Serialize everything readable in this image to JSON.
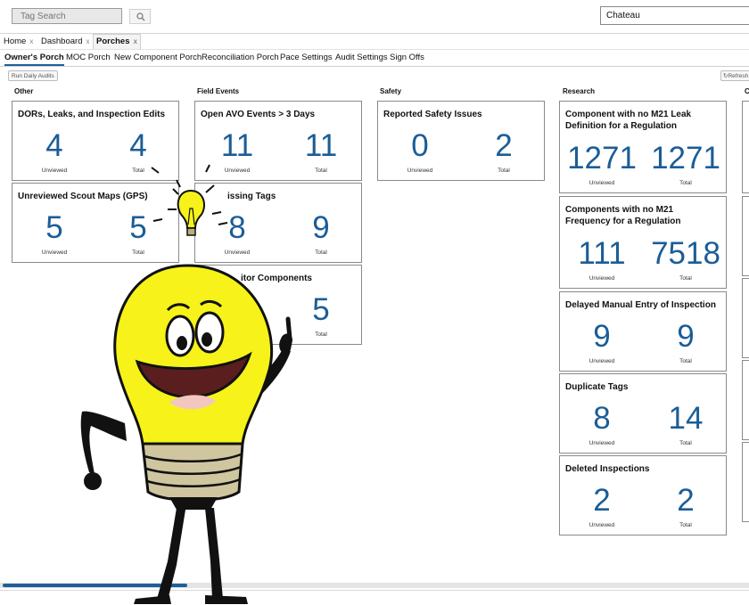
{
  "header": {
    "search_placeholder": "Tag Search",
    "site_value": "Chateau"
  },
  "nav_tabs": [
    {
      "label": "Home",
      "closable": true
    },
    {
      "label": "Dashboard",
      "closable": true
    },
    {
      "label": "Porches",
      "closable": true,
      "active": true
    }
  ],
  "close_glyph": "x",
  "sub_tabs": [
    {
      "label": "Owner's Porch",
      "active": true
    },
    {
      "label": "MOC Porch"
    },
    {
      "label": "New Component Porch"
    },
    {
      "label": "Reconciliation Porch"
    },
    {
      "label": "Pace Settings"
    },
    {
      "label": "Audit Settings"
    },
    {
      "label": "Sign Offs"
    }
  ],
  "toolbar": {
    "run_daily_audits": "Run Daily Audits",
    "refresh": "Refresh"
  },
  "labels": {
    "unviewed": "Unviewed",
    "total": "Total"
  },
  "sections": {
    "other": "Other",
    "field_events": "Field Events",
    "safety": "Safety",
    "research": "Research",
    "partial": "C"
  },
  "cards": {
    "dors": {
      "title": "DORs, Leaks, and Inspection Edits",
      "unviewed": "4",
      "total": "4"
    },
    "scout": {
      "title": "Unreviewed Scout Maps (GPS)",
      "unviewed": "5",
      "total": "5"
    },
    "avo": {
      "title": "Open AVO Events > 3 Days",
      "unviewed": "11",
      "total": "11"
    },
    "missing": {
      "title": "issing Tags",
      "unviewed": "8",
      "total": "9"
    },
    "monitor": {
      "title": "itor Components",
      "unviewed": "",
      "total": "5"
    },
    "safety": {
      "title": "Reported Safety Issues",
      "unviewed": "0",
      "total": "2"
    },
    "leak_def": {
      "title": "Component with no M21 Leak Definition for a Regulation",
      "unviewed": "1271",
      "total": "1271"
    },
    "freq": {
      "title": "Components with no M21 Frequency for a Regulation",
      "unviewed": "111",
      "total": "7518"
    },
    "delayed": {
      "title": "Delayed Manual Entry of Inspection",
      "unviewed": "9",
      "total": "9"
    },
    "duplicate": {
      "title": "Duplicate Tags",
      "unviewed": "8",
      "total": "14"
    },
    "deleted": {
      "title": "Deleted Inspections",
      "unviewed": "2",
      "total": "2"
    }
  },
  "colors": {
    "accent": "#1b5d97",
    "tab_underline": "#1f5f9c",
    "bulb": "#f6f21a"
  },
  "icons": [
    "search-icon",
    "refresh-icon",
    "lightbulb-mascot"
  ]
}
